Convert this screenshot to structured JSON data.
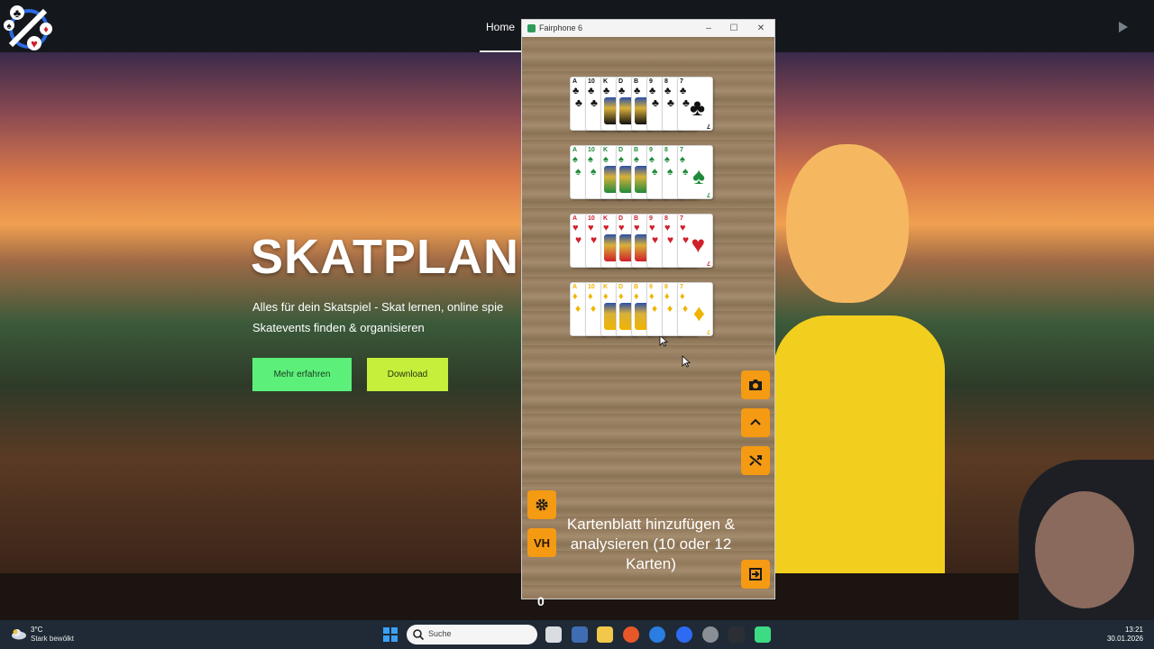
{
  "site": {
    "nav": {
      "home": "Home"
    },
    "hero": {
      "title": "SKATPLANET",
      "subtitle_line1": "Alles für dein Skatspiel - Skat lernen, online spie",
      "subtitle_line2": "Skatevents finden & organisieren",
      "button_more": "Mehr erfahren",
      "button_download": "Download"
    }
  },
  "emulator": {
    "window_title": "Fairphone 6",
    "controls": {
      "minimize": "–",
      "maximize": "☐",
      "close": "✕"
    },
    "hands": [
      {
        "suit": "clubs",
        "symbol": "♣",
        "color": "#111111",
        "ranks": [
          "A",
          "10",
          "K",
          "D",
          "B",
          "9",
          "8",
          "7"
        ]
      },
      {
        "suit": "spades",
        "symbol": "♠",
        "color": "#1f8a3a",
        "ranks": [
          "A",
          "10",
          "K",
          "D",
          "B",
          "9",
          "8",
          "7"
        ]
      },
      {
        "suit": "hearts",
        "symbol": "♥",
        "color": "#d0202a",
        "ranks": [
          "A",
          "10",
          "K",
          "D",
          "B",
          "9",
          "8",
          "7"
        ]
      },
      {
        "suit": "diamonds",
        "symbol": "♦",
        "color": "#f0b400",
        "ranks": [
          "A",
          "10",
          "K",
          "D",
          "B",
          "9",
          "8",
          "7"
        ]
      }
    ],
    "buttons": {
      "camera_icon": "camera-icon",
      "up_icon": "chevron-up-icon",
      "shuffle_icon": "shuffle-icon",
      "settings_icon": "gear-icon",
      "vh_label": "VH",
      "exit_icon": "exit-icon"
    },
    "info_text": "Kartenblatt hinzufügen & analysieren (10 oder 12 Karten)",
    "count": "0",
    "accent_color": "#f59a13"
  },
  "taskbar": {
    "weather_temp": "3°C",
    "weather_desc": "Stark bewölkt",
    "search_placeholder": "Suche",
    "time": "13:21",
    "date": "30.01.2026"
  }
}
